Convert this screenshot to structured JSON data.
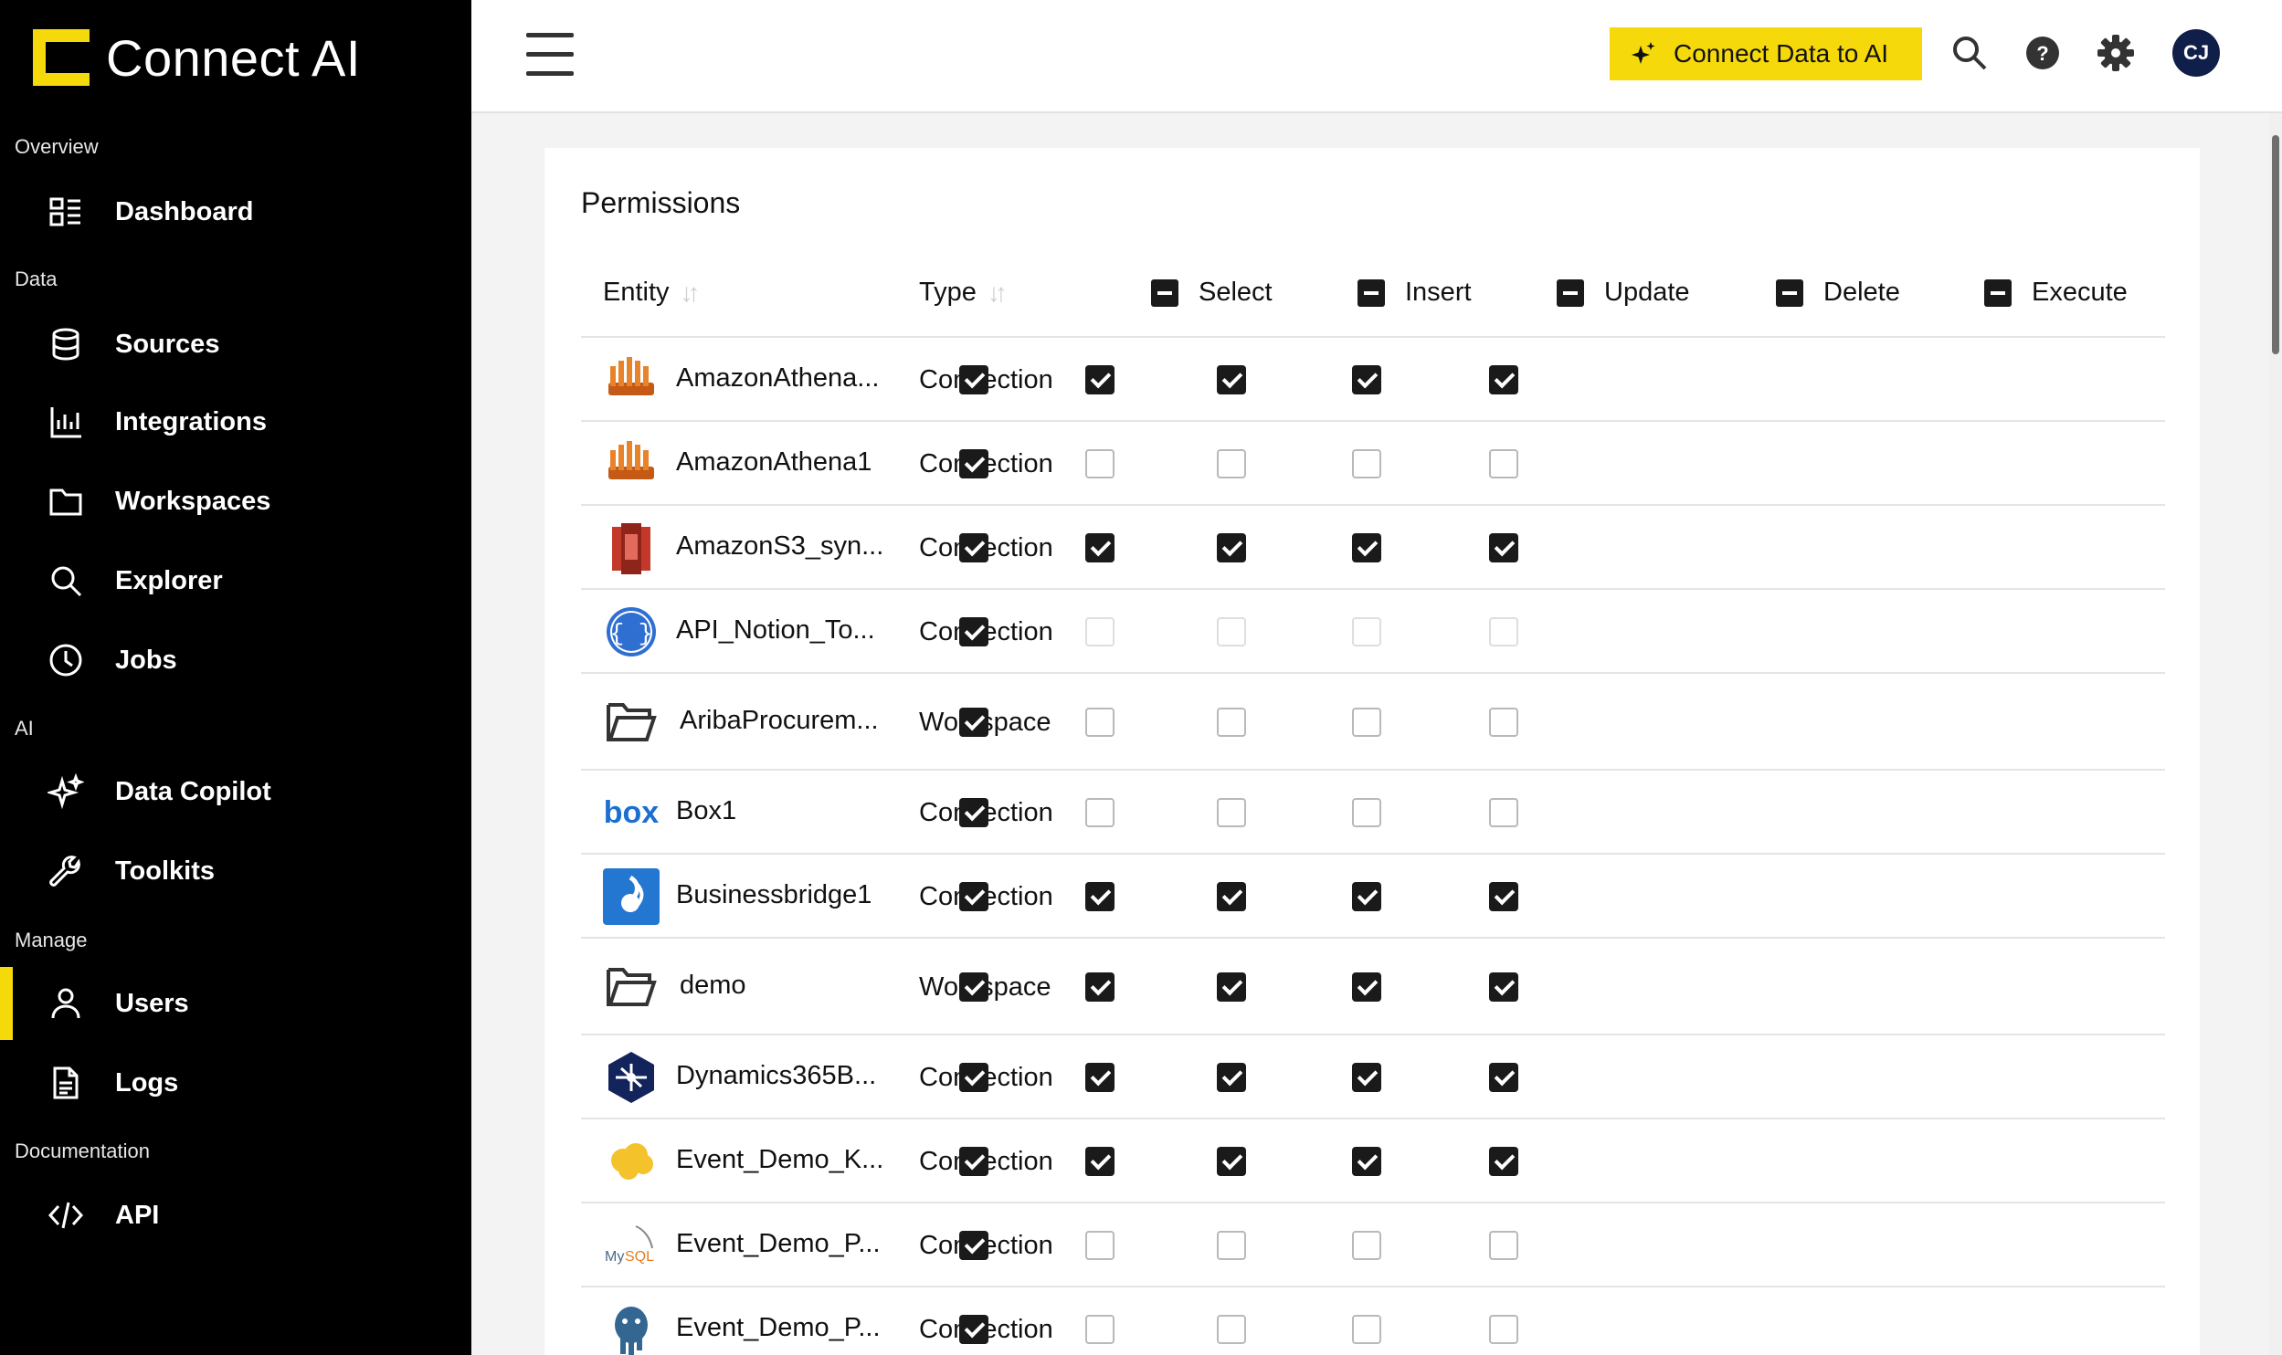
{
  "brand": {
    "name": "Connect AI",
    "accent": "#f5d90a"
  },
  "sidebar": {
    "sections": [
      {
        "label": "Overview",
        "items": [
          {
            "label": "Dashboard",
            "icon": "dashboard-icon"
          }
        ]
      },
      {
        "label": "Data",
        "items": [
          {
            "label": "Sources",
            "icon": "database-icon"
          },
          {
            "label": "Integrations",
            "icon": "bar-chart-icon"
          },
          {
            "label": "Workspaces",
            "icon": "folder-icon"
          },
          {
            "label": "Explorer",
            "icon": "search-icon"
          },
          {
            "label": "Jobs",
            "icon": "clock-icon"
          }
        ]
      },
      {
        "label": "AI",
        "items": [
          {
            "label": "Data Copilot",
            "icon": "sparkle-icon"
          },
          {
            "label": "Toolkits",
            "icon": "wrench-icon"
          }
        ]
      },
      {
        "label": "Manage",
        "items": [
          {
            "label": "Users",
            "icon": "user-icon",
            "active": true
          },
          {
            "label": "Logs",
            "icon": "document-icon"
          }
        ]
      },
      {
        "label": "Documentation",
        "items": [
          {
            "label": "API",
            "icon": "code-icon"
          }
        ]
      }
    ]
  },
  "header": {
    "cta_label": "Connect Data to AI",
    "avatar_initials": "CJ",
    "icons": [
      "menu-icon",
      "search-icon",
      "help-icon",
      "gear-icon"
    ]
  },
  "permissions": {
    "title": "Permissions",
    "columns": {
      "entity": "Entity",
      "type": "Type",
      "select": "Select",
      "insert": "Insert",
      "update": "Update",
      "delete": "Delete",
      "execute": "Execute"
    },
    "rows": [
      {
        "name": "AmazonAthena...",
        "type": "Connection",
        "icon": "amazon-athena-icon",
        "perms": [
          "on",
          "on",
          "on",
          "on",
          "on"
        ]
      },
      {
        "name": "AmazonAthena1",
        "type": "Connection",
        "icon": "amazon-athena-icon",
        "perms": [
          "on",
          "off",
          "off",
          "off",
          "off"
        ]
      },
      {
        "name": "AmazonS3_syn...",
        "type": "Connection",
        "icon": "amazon-s3-icon",
        "perms": [
          "on",
          "on",
          "on",
          "on",
          "on"
        ]
      },
      {
        "name": "API_Notion_To...",
        "type": "Connection",
        "icon": "api-braces-icon",
        "perms": [
          "on",
          "dis",
          "dis",
          "dis",
          "dis"
        ]
      },
      {
        "name": "AribaProcurem...",
        "type": "Workspace",
        "icon": "workspace-folder-icon",
        "perms": [
          "on",
          "off",
          "off",
          "off",
          "off"
        ]
      },
      {
        "name": "Box1",
        "type": "Connection",
        "icon": "box-logo-icon",
        "perms": [
          "on",
          "off",
          "off",
          "off",
          "off"
        ]
      },
      {
        "name": "Businessbridge1",
        "type": "Connection",
        "icon": "businessbridge-icon",
        "perms": [
          "on",
          "on",
          "on",
          "on",
          "on"
        ]
      },
      {
        "name": "demo",
        "type": "Workspace",
        "icon": "workspace-folder-icon",
        "perms": [
          "on",
          "on",
          "on",
          "on",
          "on"
        ]
      },
      {
        "name": "Dynamics365B...",
        "type": "Connection",
        "icon": "dynamics365-icon",
        "perms": [
          "on",
          "on",
          "on",
          "on",
          "on"
        ]
      },
      {
        "name": "Event_Demo_K...",
        "type": "Connection",
        "icon": "salesforce-cloud-icon",
        "perms": [
          "on",
          "on",
          "on",
          "on",
          "on"
        ]
      },
      {
        "name": "Event_Demo_P...",
        "type": "Connection",
        "icon": "mysql-icon",
        "perms": [
          "on",
          "off",
          "off",
          "off",
          "off"
        ]
      },
      {
        "name": "Event_Demo_P...",
        "type": "Connection",
        "icon": "postgresql-icon",
        "perms": [
          "on",
          "off",
          "off",
          "off",
          "off"
        ]
      }
    ]
  }
}
